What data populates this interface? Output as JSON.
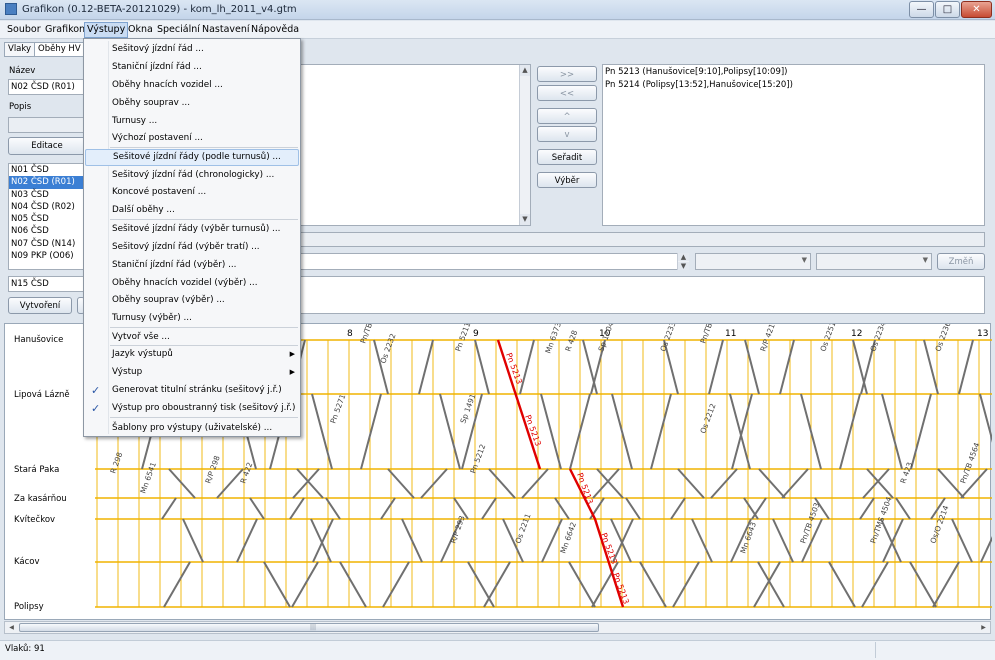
{
  "window": {
    "title": "Grafikon (0.12-BETA-20121029) - kom_lh_2011_v4.gtm",
    "buttons": {
      "minimize": "—",
      "maximize": "□",
      "close": "✕"
    }
  },
  "menubar": {
    "items": [
      "Soubor",
      "Grafikon",
      "Výstupy",
      "Okna",
      "Speciální",
      "Nastavení",
      "Nápověda"
    ]
  },
  "left": {
    "tabs": [
      "Vlaky",
      "Oběhy HV"
    ],
    "name_label": "Název",
    "name_value": "N02 ČSD (R01)",
    "desc_label": "Popis",
    "edit_button": "Editace",
    "list": [
      "N01 ČSD",
      "N02 ČSD (R01)",
      "N03 ČSD",
      "N04 ČSD (R02)",
      "N05 ČSD",
      "N06 ČSD",
      "N07 ČSD (N14)",
      "N09 PKP (O06)"
    ],
    "new_item_value": "N15 ČSD",
    "create_button": "Vytvoření"
  },
  "middle": {
    "buttons": [
      ">>",
      "<<",
      "^",
      "v",
      "Seřadit",
      "Výběr"
    ]
  },
  "right": {
    "list": [
      "Pn 5213 (Hanušovice[9:10],Polipsy[10:09])",
      "Pn 5214 (Polipsy[13:52],Hanušovice[15:20])"
    ],
    "change_button": "Změň"
  },
  "dropdown": {
    "items": [
      {
        "label": "Sešitový jízdní řád ..."
      },
      {
        "label": "Staniční jízdní řád ..."
      },
      {
        "label": "Oběhy hnacích vozidel ..."
      },
      {
        "label": "Oběhy souprav ..."
      },
      {
        "label": "Turnusy ..."
      },
      {
        "label": "Výchozí postavení ..."
      },
      {
        "label": "Sešitové jízdní řády (podle turnusů) ...",
        "highlighted": true
      },
      {
        "label": "Sešitový jízdní řád (chronologicky) ..."
      },
      {
        "label": "Koncové postavení ..."
      },
      {
        "label": "Další oběhy ..."
      },
      {
        "label": "Sešitové jízdní řády (výběr turnusů) ..."
      },
      {
        "label": "Sešitový jízdní řád (výběr tratí) ..."
      },
      {
        "label": "Staniční jízdní řád (výběr) ..."
      },
      {
        "label": "Oběhy hnacích vozidel (výběr) ..."
      },
      {
        "label": "Oběhy souprav (výběr) ..."
      },
      {
        "label": "Turnusy (výběr) ..."
      },
      {
        "label": "Vytvoř vše ..."
      },
      {
        "label": "Jazyk výstupů",
        "submenu": true
      },
      {
        "label": "Výstup",
        "submenu": true
      },
      {
        "label": "Generovat titulní stránku (sešitový j.ř.)",
        "checked": true
      },
      {
        "label": "Výstup pro oboustranný tisk (sešitový j.ř.)",
        "checked": true
      },
      {
        "label": "Šablony pro výstupy (uživatelské) ..."
      }
    ]
  },
  "graph": {
    "stations": [
      "Hanušovice",
      "Lipová Lázně",
      "Stará Paka",
      "Za kasárňou",
      "Kvítečkov",
      "Kácov",
      "Polipsy"
    ],
    "hours": [
      "8",
      "9",
      "10",
      "11",
      "12",
      "13"
    ],
    "colors": {
      "grid": "#f0b400",
      "train": "#707070",
      "selected": "#e00000"
    },
    "train_labels": [
      "Pn 5213",
      "Os 2232",
      "Pn/TB 4511",
      "Pn 5211",
      "Mn 6373",
      "R 428",
      "Sp 1204",
      "Os 2233",
      "Pn/TB 4512",
      "R/P 421",
      "Os 2251",
      "Os 2234",
      "Os 2236",
      "Pn 5271",
      "Sp 1491",
      "Os 2212",
      "R/P 298",
      "R 298",
      "Mn 6541",
      "R 422",
      "Pn 5212",
      "Os 2211",
      "Mn 6642",
      "R/P 293",
      "Pn/TMS 4504",
      "Pn/TB 4503",
      "Os/O 2214",
      "Mn 6643",
      "R 423",
      "Pn/TB 4564"
    ]
  },
  "status": {
    "text": "Vlaků: 91"
  },
  "hscroll": {
    "left_arrow": "◀",
    "right_arrow": "▶",
    "grip": "|||"
  }
}
